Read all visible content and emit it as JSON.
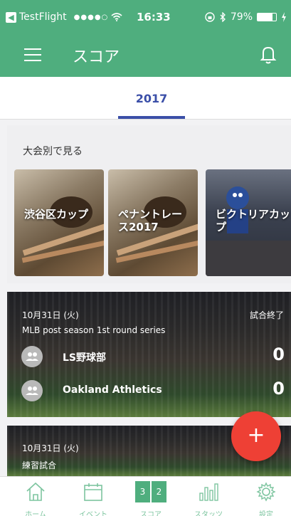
{
  "status_bar": {
    "back_app": "TestFlight",
    "signal": "●●●●○",
    "time": "16:33",
    "battery": "79%",
    "battery_level": 0.79
  },
  "app_bar": {
    "title": "スコア"
  },
  "tabs": [
    {
      "label": "2017"
    }
  ],
  "by_tournament": {
    "title": "大会別で見る",
    "cards": [
      {
        "label": "渋谷区カップ"
      },
      {
        "label": "ペナントレース2017"
      },
      {
        "label": "ビクトリアカップ"
      }
    ]
  },
  "games": [
    {
      "date": "10月31日 (火)",
      "status": "試合終了",
      "name": "MLB post season 1st round series",
      "teams": [
        {
          "name": "LS野球部",
          "score": "0"
        },
        {
          "name": "Oakland Athletics",
          "score": "0"
        }
      ]
    },
    {
      "date": "10月31日 (火)",
      "name": "練習試合"
    }
  ],
  "fab": {
    "label": "+"
  },
  "bottom_nav": [
    {
      "label": "ホーム"
    },
    {
      "label": "イベント"
    },
    {
      "label": "スコア",
      "icon_text": [
        "3",
        "2"
      ]
    },
    {
      "label": "スタッツ"
    },
    {
      "label": "設定"
    }
  ],
  "colors": {
    "primary": "#4fae7e",
    "accent": "#3b4fa8",
    "fab": "#ee4035",
    "nav_label": "#7dc59f"
  }
}
